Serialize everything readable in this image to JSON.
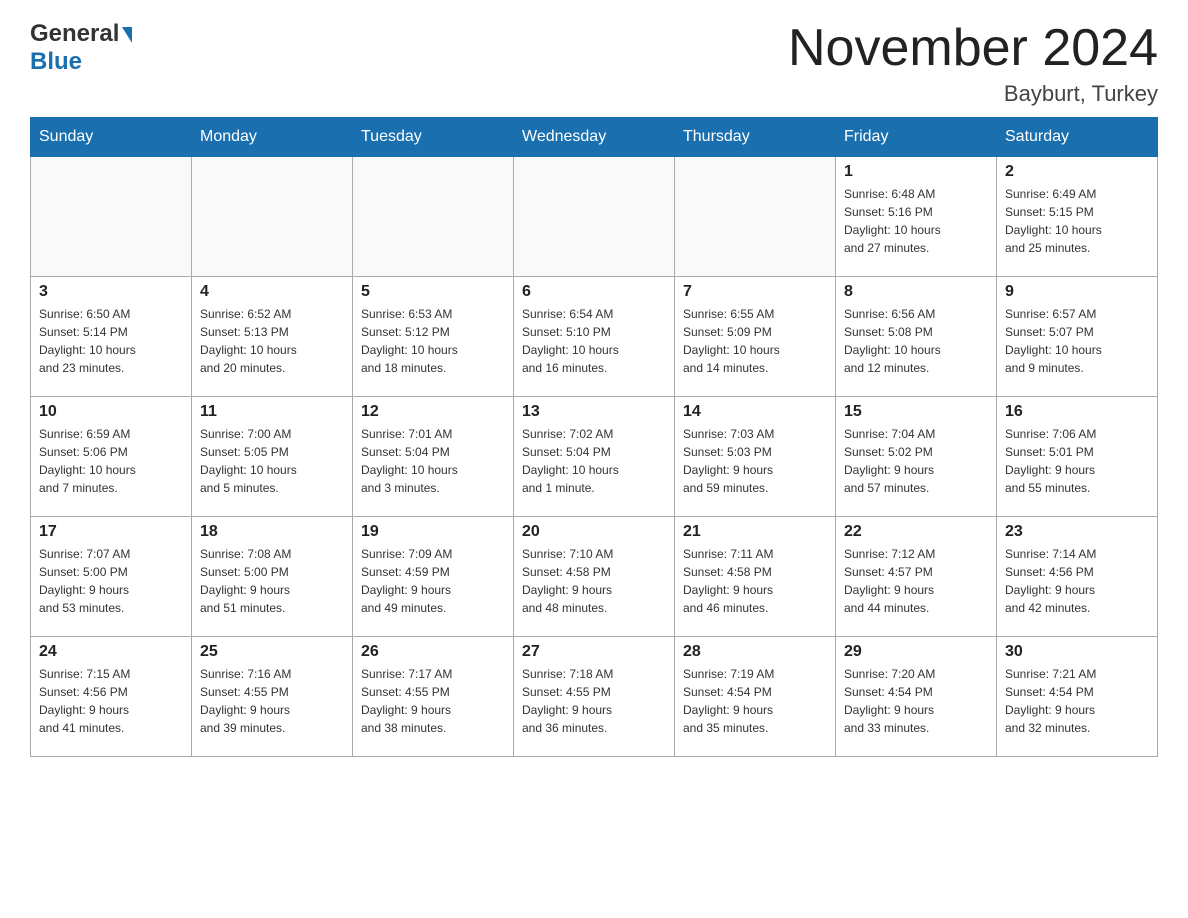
{
  "header": {
    "logo_line1": "General",
    "logo_triangle": "▶",
    "logo_line2": "Blue",
    "month_title": "November 2024",
    "location": "Bayburt, Turkey"
  },
  "weekdays": [
    "Sunday",
    "Monday",
    "Tuesday",
    "Wednesday",
    "Thursday",
    "Friday",
    "Saturday"
  ],
  "weeks": [
    [
      {
        "day": "",
        "info": ""
      },
      {
        "day": "",
        "info": ""
      },
      {
        "day": "",
        "info": ""
      },
      {
        "day": "",
        "info": ""
      },
      {
        "day": "",
        "info": ""
      },
      {
        "day": "1",
        "info": "Sunrise: 6:48 AM\nSunset: 5:16 PM\nDaylight: 10 hours\nand 27 minutes."
      },
      {
        "day": "2",
        "info": "Sunrise: 6:49 AM\nSunset: 5:15 PM\nDaylight: 10 hours\nand 25 minutes."
      }
    ],
    [
      {
        "day": "3",
        "info": "Sunrise: 6:50 AM\nSunset: 5:14 PM\nDaylight: 10 hours\nand 23 minutes."
      },
      {
        "day": "4",
        "info": "Sunrise: 6:52 AM\nSunset: 5:13 PM\nDaylight: 10 hours\nand 20 minutes."
      },
      {
        "day": "5",
        "info": "Sunrise: 6:53 AM\nSunset: 5:12 PM\nDaylight: 10 hours\nand 18 minutes."
      },
      {
        "day": "6",
        "info": "Sunrise: 6:54 AM\nSunset: 5:10 PM\nDaylight: 10 hours\nand 16 minutes."
      },
      {
        "day": "7",
        "info": "Sunrise: 6:55 AM\nSunset: 5:09 PM\nDaylight: 10 hours\nand 14 minutes."
      },
      {
        "day": "8",
        "info": "Sunrise: 6:56 AM\nSunset: 5:08 PM\nDaylight: 10 hours\nand 12 minutes."
      },
      {
        "day": "9",
        "info": "Sunrise: 6:57 AM\nSunset: 5:07 PM\nDaylight: 10 hours\nand 9 minutes."
      }
    ],
    [
      {
        "day": "10",
        "info": "Sunrise: 6:59 AM\nSunset: 5:06 PM\nDaylight: 10 hours\nand 7 minutes."
      },
      {
        "day": "11",
        "info": "Sunrise: 7:00 AM\nSunset: 5:05 PM\nDaylight: 10 hours\nand 5 minutes."
      },
      {
        "day": "12",
        "info": "Sunrise: 7:01 AM\nSunset: 5:04 PM\nDaylight: 10 hours\nand 3 minutes."
      },
      {
        "day": "13",
        "info": "Sunrise: 7:02 AM\nSunset: 5:04 PM\nDaylight: 10 hours\nand 1 minute."
      },
      {
        "day": "14",
        "info": "Sunrise: 7:03 AM\nSunset: 5:03 PM\nDaylight: 9 hours\nand 59 minutes."
      },
      {
        "day": "15",
        "info": "Sunrise: 7:04 AM\nSunset: 5:02 PM\nDaylight: 9 hours\nand 57 minutes."
      },
      {
        "day": "16",
        "info": "Sunrise: 7:06 AM\nSunset: 5:01 PM\nDaylight: 9 hours\nand 55 minutes."
      }
    ],
    [
      {
        "day": "17",
        "info": "Sunrise: 7:07 AM\nSunset: 5:00 PM\nDaylight: 9 hours\nand 53 minutes."
      },
      {
        "day": "18",
        "info": "Sunrise: 7:08 AM\nSunset: 5:00 PM\nDaylight: 9 hours\nand 51 minutes."
      },
      {
        "day": "19",
        "info": "Sunrise: 7:09 AM\nSunset: 4:59 PM\nDaylight: 9 hours\nand 49 minutes."
      },
      {
        "day": "20",
        "info": "Sunrise: 7:10 AM\nSunset: 4:58 PM\nDaylight: 9 hours\nand 48 minutes."
      },
      {
        "day": "21",
        "info": "Sunrise: 7:11 AM\nSunset: 4:58 PM\nDaylight: 9 hours\nand 46 minutes."
      },
      {
        "day": "22",
        "info": "Sunrise: 7:12 AM\nSunset: 4:57 PM\nDaylight: 9 hours\nand 44 minutes."
      },
      {
        "day": "23",
        "info": "Sunrise: 7:14 AM\nSunset: 4:56 PM\nDaylight: 9 hours\nand 42 minutes."
      }
    ],
    [
      {
        "day": "24",
        "info": "Sunrise: 7:15 AM\nSunset: 4:56 PM\nDaylight: 9 hours\nand 41 minutes."
      },
      {
        "day": "25",
        "info": "Sunrise: 7:16 AM\nSunset: 4:55 PM\nDaylight: 9 hours\nand 39 minutes."
      },
      {
        "day": "26",
        "info": "Sunrise: 7:17 AM\nSunset: 4:55 PM\nDaylight: 9 hours\nand 38 minutes."
      },
      {
        "day": "27",
        "info": "Sunrise: 7:18 AM\nSunset: 4:55 PM\nDaylight: 9 hours\nand 36 minutes."
      },
      {
        "day": "28",
        "info": "Sunrise: 7:19 AM\nSunset: 4:54 PM\nDaylight: 9 hours\nand 35 minutes."
      },
      {
        "day": "29",
        "info": "Sunrise: 7:20 AM\nSunset: 4:54 PM\nDaylight: 9 hours\nand 33 minutes."
      },
      {
        "day": "30",
        "info": "Sunrise: 7:21 AM\nSunset: 4:54 PM\nDaylight: 9 hours\nand 32 minutes."
      }
    ]
  ]
}
